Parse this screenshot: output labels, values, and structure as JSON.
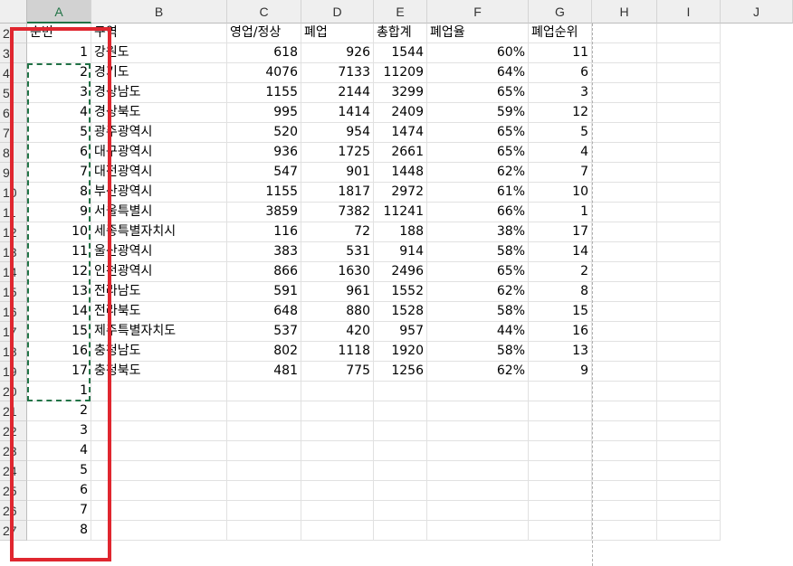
{
  "columns": [
    "A",
    "B",
    "C",
    "D",
    "E",
    "F",
    "G",
    "H",
    "I",
    "J"
  ],
  "selected_column": "A",
  "row_numbers": [
    "2",
    "3",
    "4",
    "5",
    "6",
    "7",
    "8",
    "9",
    "10",
    "11",
    "12",
    "13",
    "14",
    "15",
    "16",
    "17",
    "18",
    "19",
    "20",
    "21",
    "22",
    "23",
    "24",
    "25",
    "26",
    "27"
  ],
  "headers": {
    "a": "순번",
    "b": "구역",
    "c": "영업/정상",
    "d": "폐업",
    "e": "총합계",
    "f": "폐업율",
    "g": "폐업순위"
  },
  "rows": [
    {
      "a": "1",
      "b": "강원도",
      "c": "618",
      "d": "926",
      "e": "1544",
      "f": "60%",
      "g": "11"
    },
    {
      "a": "2",
      "b": "경기도",
      "c": "4076",
      "d": "7133",
      "e": "11209",
      "f": "64%",
      "g": "6"
    },
    {
      "a": "3",
      "b": "경상남도",
      "c": "1155",
      "d": "2144",
      "e": "3299",
      "f": "65%",
      "g": "3"
    },
    {
      "a": "4",
      "b": "경상북도",
      "c": "995",
      "d": "1414",
      "e": "2409",
      "f": "59%",
      "g": "12"
    },
    {
      "a": "5",
      "b": "광주광역시",
      "c": "520",
      "d": "954",
      "e": "1474",
      "f": "65%",
      "g": "5"
    },
    {
      "a": "6",
      "b": "대구광역시",
      "c": "936",
      "d": "1725",
      "e": "2661",
      "f": "65%",
      "g": "4"
    },
    {
      "a": "7",
      "b": "대전광역시",
      "c": "547",
      "d": "901",
      "e": "1448",
      "f": "62%",
      "g": "7"
    },
    {
      "a": "8",
      "b": "부산광역시",
      "c": "1155",
      "d": "1817",
      "e": "2972",
      "f": "61%",
      "g": "10"
    },
    {
      "a": "9",
      "b": "서울특별시",
      "c": "3859",
      "d": "7382",
      "e": "11241",
      "f": "66%",
      "g": "1"
    },
    {
      "a": "10",
      "b": "세종특별자치시",
      "c": "116",
      "d": "72",
      "e": "188",
      "f": "38%",
      "g": "17"
    },
    {
      "a": "11",
      "b": "울산광역시",
      "c": "383",
      "d": "531",
      "e": "914",
      "f": "58%",
      "g": "14"
    },
    {
      "a": "12",
      "b": "인천광역시",
      "c": "866",
      "d": "1630",
      "e": "2496",
      "f": "65%",
      "g": "2"
    },
    {
      "a": "13",
      "b": "전라남도",
      "c": "591",
      "d": "961",
      "e": "1552",
      "f": "62%",
      "g": "8"
    },
    {
      "a": "14",
      "b": "전라북도",
      "c": "648",
      "d": "880",
      "e": "1528",
      "f": "58%",
      "g": "15"
    },
    {
      "a": "15",
      "b": "제주특별자치도",
      "c": "537",
      "d": "420",
      "e": "957",
      "f": "44%",
      "g": "16"
    },
    {
      "a": "16",
      "b": "충청남도",
      "c": "802",
      "d": "1118",
      "e": "1920",
      "f": "58%",
      "g": "13"
    },
    {
      "a": "17",
      "b": "충청북도",
      "c": "481",
      "d": "775",
      "e": "1256",
      "f": "62%",
      "g": "9"
    },
    {
      "a": "1"
    },
    {
      "a": "2"
    },
    {
      "a": "3"
    },
    {
      "a": "4"
    },
    {
      "a": "5"
    },
    {
      "a": "6"
    },
    {
      "a": "7"
    },
    {
      "a": "8"
    }
  ]
}
